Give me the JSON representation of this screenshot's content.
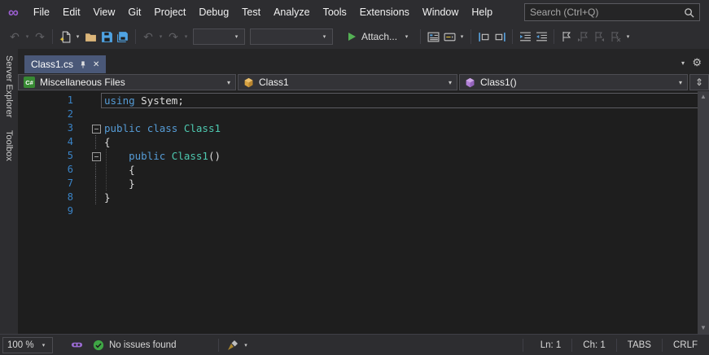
{
  "menu_bar": {
    "items": [
      "File",
      "Edit",
      "View",
      "Git",
      "Project",
      "Debug",
      "Test",
      "Analyze",
      "Tools",
      "Extensions",
      "Window",
      "Help"
    ],
    "search_placeholder": "Search (Ctrl+Q)"
  },
  "toolbar": {
    "attach_label": "Attach..."
  },
  "side_panel_tabs": [
    "Server Explorer",
    "Toolbox"
  ],
  "document_well": {
    "tab_title": "Class1.cs"
  },
  "navigation_bar": {
    "project": "Miscellaneous Files",
    "project_badge": "C#",
    "type": "Class1",
    "member": "Class1()"
  },
  "editor": {
    "lines": [
      {
        "number": "1",
        "fold": "",
        "current": true,
        "tokens": [
          [
            "using",
            "kw"
          ],
          [
            " ",
            "pl"
          ],
          [
            "System;",
            "pl"
          ]
        ]
      },
      {
        "number": "2",
        "fold": "",
        "current": false,
        "tokens": []
      },
      {
        "number": "3",
        "fold": "box",
        "current": false,
        "tokens": [
          [
            "public",
            "kw"
          ],
          [
            " ",
            "pl"
          ],
          [
            "class",
            "kw"
          ],
          [
            " ",
            "pl"
          ],
          [
            "Class1",
            "ty"
          ]
        ]
      },
      {
        "number": "4",
        "fold": "bar",
        "current": false,
        "tokens": [
          [
            "{",
            "pl"
          ]
        ]
      },
      {
        "number": "5",
        "fold": "box",
        "current": false,
        "tokens": [
          [
            "    ",
            "pl"
          ],
          [
            "public",
            "kw"
          ],
          [
            " ",
            "pl"
          ],
          [
            "Class1",
            "ty"
          ],
          [
            "()",
            "pl"
          ]
        ]
      },
      {
        "number": "6",
        "fold": "bar",
        "current": false,
        "tokens": [
          [
            "    {",
            "pl"
          ]
        ]
      },
      {
        "number": "7",
        "fold": "bar",
        "current": false,
        "tokens": [
          [
            "    }",
            "pl"
          ]
        ]
      },
      {
        "number": "8",
        "fold": "bar",
        "current": false,
        "tokens": [
          [
            "}",
            "pl"
          ]
        ]
      },
      {
        "number": "9",
        "fold": "",
        "current": false,
        "tokens": []
      }
    ]
  },
  "status_bar": {
    "zoom": "100 %",
    "message": "No issues found",
    "line": "Ln: 1",
    "column": "Ch: 1",
    "indent": "TABS",
    "eol": "CRLF"
  },
  "icons": {
    "logo": "∞",
    "dropdown": "▾",
    "back": "↶",
    "forward": "↷",
    "undo": "↶",
    "redo": "↷",
    "close": "✕",
    "gear": "⚙",
    "scroll_up": "▲",
    "scroll_down": "▼",
    "split_toggle": "⇕"
  },
  "colors": {
    "chrome": "#2D2D30",
    "docwell": "#252526",
    "editor_background": "#1E1E1E",
    "active_tab": "#4A5878",
    "keyword": "#569CD6",
    "type_name": "#4EC9B0",
    "plain_text": "#DCDCDC",
    "line_number": "#3A84C8",
    "success_green": "#3FA645",
    "logo_purple": "#9B5FD0",
    "save_blue": "#4FA3E3",
    "folder_tan": "#DCB67A"
  }
}
